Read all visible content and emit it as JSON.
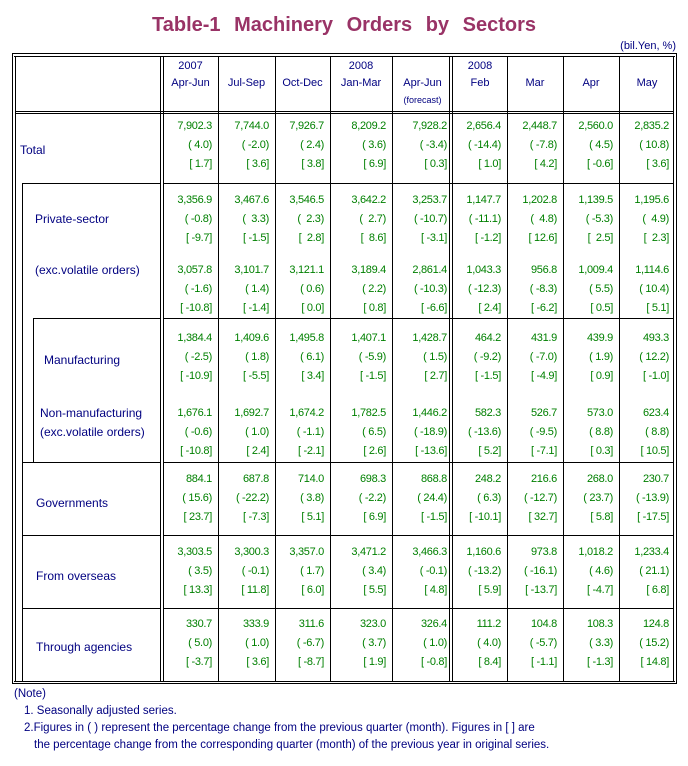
{
  "title": "Table-1  Machinery  Orders  by  Sectors",
  "unit": "(bil.Yen, %)",
  "columns": [
    {
      "year": "2007",
      "period": "Apr-Jun",
      "sub": ""
    },
    {
      "year": "",
      "period": "Jul-Sep",
      "sub": ""
    },
    {
      "year": "",
      "period": "Oct-Dec",
      "sub": ""
    },
    {
      "year": "2008",
      "period": "Jan-Mar",
      "sub": ""
    },
    {
      "year": "",
      "period": "Apr-Jun",
      "sub": "(forecast)"
    },
    {
      "year": "2008",
      "period": "Feb",
      "sub": ""
    },
    {
      "year": "",
      "period": "Mar",
      "sub": ""
    },
    {
      "year": "",
      "period": "Apr",
      "sub": ""
    },
    {
      "year": "",
      "period": "May",
      "sub": ""
    }
  ],
  "rows": [
    {
      "label": "Total",
      "label2": "",
      "values": [
        [
          "7,902.3",
          "( 4.0)",
          "[ 1.7]"
        ],
        [
          "7,744.0",
          "( -2.0)",
          "[ 3.6]"
        ],
        [
          "7,926.7",
          "( 2.4)",
          "[ 3.8]"
        ],
        [
          "8,209.2",
          "( 3.6)",
          "[ 6.9]"
        ],
        [
          "7,928.2",
          "( -3.4)",
          "[ 0.3]"
        ],
        [
          "2,656.4",
          "( -14.4)",
          "[ 1.0]"
        ],
        [
          "2,448.7",
          "( -7.8)",
          "[ 4.2]"
        ],
        [
          "2,560.0",
          "( 4.5)",
          "[ -0.6]"
        ],
        [
          "2,835.2",
          "( 10.8)",
          "[ 3.6]"
        ]
      ]
    },
    {
      "label": "Private-sector",
      "label2": "",
      "values": [
        [
          "3,356.9",
          "( -0.8)",
          "[ -9.7]"
        ],
        [
          "3,467.6",
          "(  3.3)",
          "[ -1.5]"
        ],
        [
          "3,546.5",
          "(  2.3)",
          "[  2.8]"
        ],
        [
          "3,642.2",
          "(  2.7)",
          "[  8.6]"
        ],
        [
          "3,253.7",
          "( -10.7)",
          "[ -3.1]"
        ],
        [
          "1,147.7",
          "( -11.1)",
          "[ -1.2]"
        ],
        [
          "1,202.8",
          "(  4.8)",
          "[ 12.6]"
        ],
        [
          "1,139.5",
          "( -5.3)",
          "[  2.5]"
        ],
        [
          "1,195.6",
          "(  4.9)",
          "[  2.3]"
        ]
      ]
    },
    {
      "label": "(exc.volatile orders)",
      "label2": "",
      "values": [
        [
          "3,057.8",
          "( -1.6)",
          "[ -10.8]"
        ],
        [
          "3,101.7",
          "( 1.4)",
          "[ -1.4]"
        ],
        [
          "3,121.1",
          "( 0.6)",
          "[ 0.0]"
        ],
        [
          "3,189.4",
          "( 2.2)",
          "[ 0.8]"
        ],
        [
          "2,861.4",
          "( -10.3)",
          "[ -6.6]"
        ],
        [
          "1,043.3",
          "( -12.3)",
          "[ 2.4]"
        ],
        [
          "956.8",
          "( -8.3)",
          "[ -6.2]"
        ],
        [
          "1,009.4",
          "( 5.5)",
          "[ 0.5]"
        ],
        [
          "1,114.6",
          "( 10.4)",
          "[ 5.1]"
        ]
      ]
    },
    {
      "label": "Manufacturing",
      "label2": "",
      "values": [
        [
          "1,384.4",
          "( -2.5)",
          "[ -10.9]"
        ],
        [
          "1,409.6",
          "( 1.8)",
          "[ -5.5]"
        ],
        [
          "1,495.8",
          "( 6.1)",
          "[ 3.4]"
        ],
        [
          "1,407.1",
          "( -5.9)",
          "[ -1.5]"
        ],
        [
          "1,428.7",
          "( 1.5)",
          "[ 2.7]"
        ],
        [
          "464.2",
          "( -9.2)",
          "[ -1.5]"
        ],
        [
          "431.9",
          "( -7.0)",
          "[ -4.9]"
        ],
        [
          "439.9",
          "( 1.9)",
          "[ 0.9]"
        ],
        [
          "493.3",
          "( 12.2)",
          "[ -1.0]"
        ]
      ]
    },
    {
      "label": "Non-manufacturing",
      "label2": "(exc.volatile orders)",
      "values": [
        [
          "1,676.1",
          "( -0.6)",
          "[ -10.8]"
        ],
        [
          "1,692.7",
          "( 1.0)",
          "[ 2.4]"
        ],
        [
          "1,674.2",
          "( -1.1)",
          "[ -2.1]"
        ],
        [
          "1,782.5",
          "( 6.5)",
          "[ 2.6]"
        ],
        [
          "1,446.2",
          "( -18.9)",
          "[ -13.6]"
        ],
        [
          "582.3",
          "( -13.6)",
          "[ 5.2]"
        ],
        [
          "526.7",
          "( -9.5)",
          "[ -7.1]"
        ],
        [
          "573.0",
          "( 8.8)",
          "[ 0.3]"
        ],
        [
          "623.4",
          "( 8.8)",
          "[ 10.5]"
        ]
      ]
    },
    {
      "label": "Governments",
      "label2": "",
      "values": [
        [
          "884.1",
          "( 15.6)",
          "[ 23.7]"
        ],
        [
          "687.8",
          "( -22.2)",
          "[ -7.3]"
        ],
        [
          "714.0",
          "( 3.8)",
          "[ 5.1]"
        ],
        [
          "698.3",
          "( -2.2)",
          "[ 6.9]"
        ],
        [
          "868.8",
          "( 24.4)",
          "[ -1.5]"
        ],
        [
          "248.2",
          "( 6.3)",
          "[ -10.1]"
        ],
        [
          "216.6",
          "( -12.7)",
          "[ 32.7]"
        ],
        [
          "268.0",
          "( 23.7)",
          "[ 5.8]"
        ],
        [
          "230.7",
          "( -13.9)",
          "[ -17.5]"
        ]
      ]
    },
    {
      "label": "From overseas",
      "label2": "",
      "values": [
        [
          "3,303.5",
          "( 3.5)",
          "[ 13.3]"
        ],
        [
          "3,300.3",
          "( -0.1)",
          "[ 11.8]"
        ],
        [
          "3,357.0",
          "( 1.7)",
          "[ 6.0]"
        ],
        [
          "3,471.2",
          "( 3.4)",
          "[ 5.5]"
        ],
        [
          "3,466.3",
          "( -0.1)",
          "[ 4.8]"
        ],
        [
          "1,160.6",
          "( -13.2)",
          "[ 5.9]"
        ],
        [
          "973.8",
          "( -16.1)",
          "[ -13.7]"
        ],
        [
          "1,018.2",
          "( 4.6)",
          "[ -4.7]"
        ],
        [
          "1,233.4",
          "( 21.1)",
          "[ 6.8]"
        ]
      ]
    },
    {
      "label": "Through agencies",
      "label2": "",
      "values": [
        [
          "330.7",
          "( 5.0)",
          "[ -3.7]"
        ],
        [
          "333.9",
          "( 1.0)",
          "[ 3.6]"
        ],
        [
          "311.6",
          "( -6.7)",
          "[ -8.7]"
        ],
        [
          "323.0",
          "( 3.7)",
          "[ 1.9]"
        ],
        [
          "326.4",
          "( 1.0)",
          "[ -0.8]"
        ],
        [
          "111.2",
          "( 4.0)",
          "[ 8.4]"
        ],
        [
          "104.8",
          "( -5.7)",
          "[ -1.1]"
        ],
        [
          "108.3",
          "( 3.3)",
          "[ -1.3]"
        ],
        [
          "124.8",
          "( 15.2)",
          "[ 14.8]"
        ]
      ]
    }
  ],
  "notes": {
    "heading": "(Note)",
    "items": [
      "1. Seasonally adjusted series.",
      "2.Figures in ( ) represent the percentage change from the previous quarter (month). Figures in [ ] are",
      "the percentage change from the corresponding quarter (month) of the previous year in original series."
    ]
  },
  "colors": {
    "title": "#993366",
    "label": "#000080",
    "value": "#008000"
  }
}
